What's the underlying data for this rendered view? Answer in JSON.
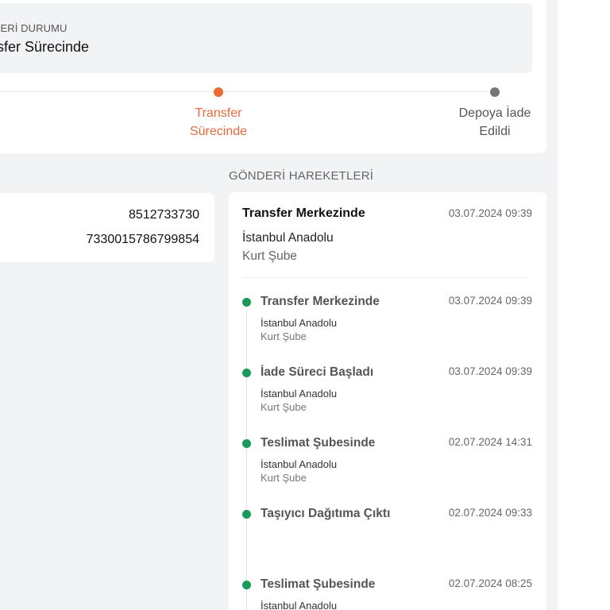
{
  "status": {
    "label": "DERİ DURUMU",
    "value": "nsfer Sürecinde"
  },
  "progress": {
    "steps": [
      {
        "label_line1": "Transfer",
        "label_line2": "Sürecinde",
        "state": "active",
        "color": "#ee6a33"
      },
      {
        "label_line1": "Depoya İade",
        "label_line2": "Edildi",
        "state": "pending",
        "color": "#777777"
      }
    ]
  },
  "section_title": "GÖNDERİ HAREKETLERİ",
  "info": {
    "value1": "8512733730",
    "value2": "7330015786799854"
  },
  "latest": {
    "title": "Transfer Merkezinde",
    "time": "03.07.2024 09:39",
    "location_line1": "İstanbul Anadolu",
    "location_line2": "Kurt Şube"
  },
  "timeline": [
    {
      "title": "Transfer Merkezinde",
      "time": "03.07.2024 09:39",
      "loc1": "İstanbul Anadolu",
      "loc2": "Kurt Şube"
    },
    {
      "title": "İade Süreci Başladı",
      "time": "03.07.2024 09:39",
      "loc1": "İstanbul Anadolu",
      "loc2": "Kurt Şube"
    },
    {
      "title": "Teslimat Şubesinde",
      "time": "02.07.2024 14:31",
      "loc1": "İstanbul Anadolu",
      "loc2": "Kurt Şube"
    },
    {
      "title": "Taşıyıcı Dağıtıma Çıktı",
      "time": "02.07.2024 09:33",
      "loc1": "",
      "loc2": ""
    },
    {
      "title": "Teslimat Şubesinde",
      "time": "02.07.2024 08:25",
      "loc1": "İstanbul Anadolu",
      "loc2": ""
    }
  ],
  "colors": {
    "accent": "#ee6a33",
    "success": "#1a9a59"
  }
}
